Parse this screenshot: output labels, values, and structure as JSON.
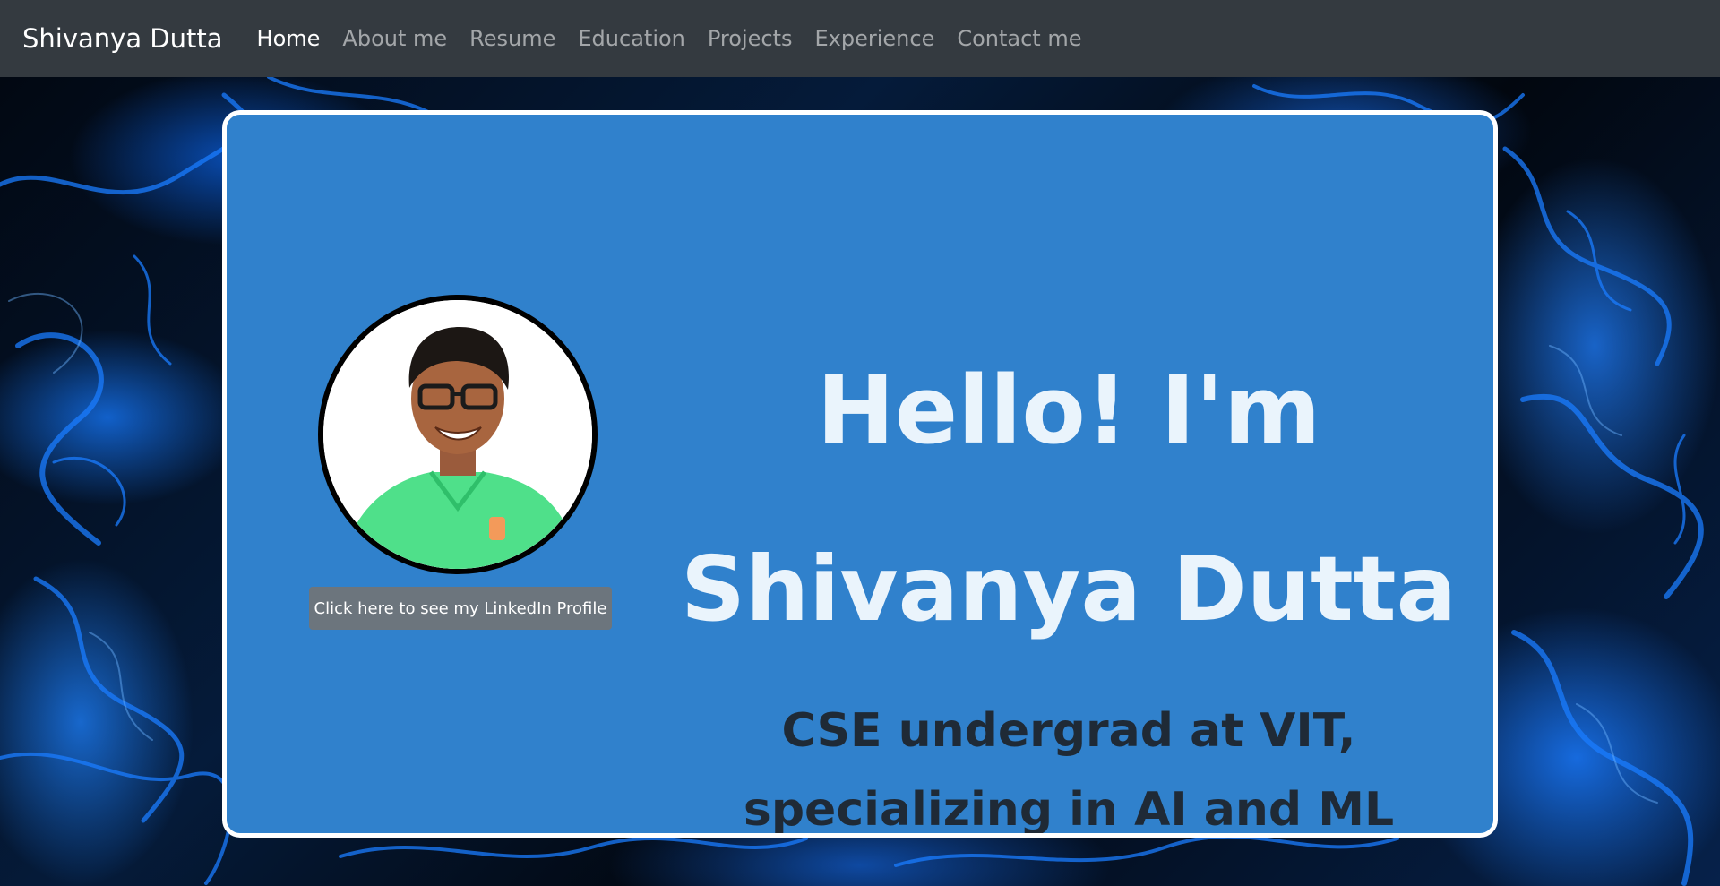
{
  "navbar": {
    "brand": "Shivanya Dutta",
    "links": [
      {
        "label": "Home",
        "active": true
      },
      {
        "label": "About me",
        "active": false
      },
      {
        "label": "Resume",
        "active": false
      },
      {
        "label": "Education",
        "active": false
      },
      {
        "label": "Projects",
        "active": false
      },
      {
        "label": "Experience",
        "active": false
      },
      {
        "label": "Contact me",
        "active": false
      }
    ]
  },
  "hero": {
    "greeting": "Hello! I'm",
    "name": "Shivanya Dutta",
    "tagline_line1": "CSE undergrad at VIT,",
    "tagline_line2": "specializing in AI and ML",
    "linkedin_button": "Click here to see my LinkedIn Profile"
  },
  "colors": {
    "navbar_bg": "#343a40",
    "card_bg": "#3081cc",
    "card_border": "#ffffff",
    "button_bg": "#6c757d",
    "heading_text": "#eaf4fc",
    "tagline_text": "#1f2a36",
    "shirt": "#4fe08a",
    "background_smoke": "#1a7cff"
  },
  "icons": {
    "profile_photo": "person-photo"
  }
}
